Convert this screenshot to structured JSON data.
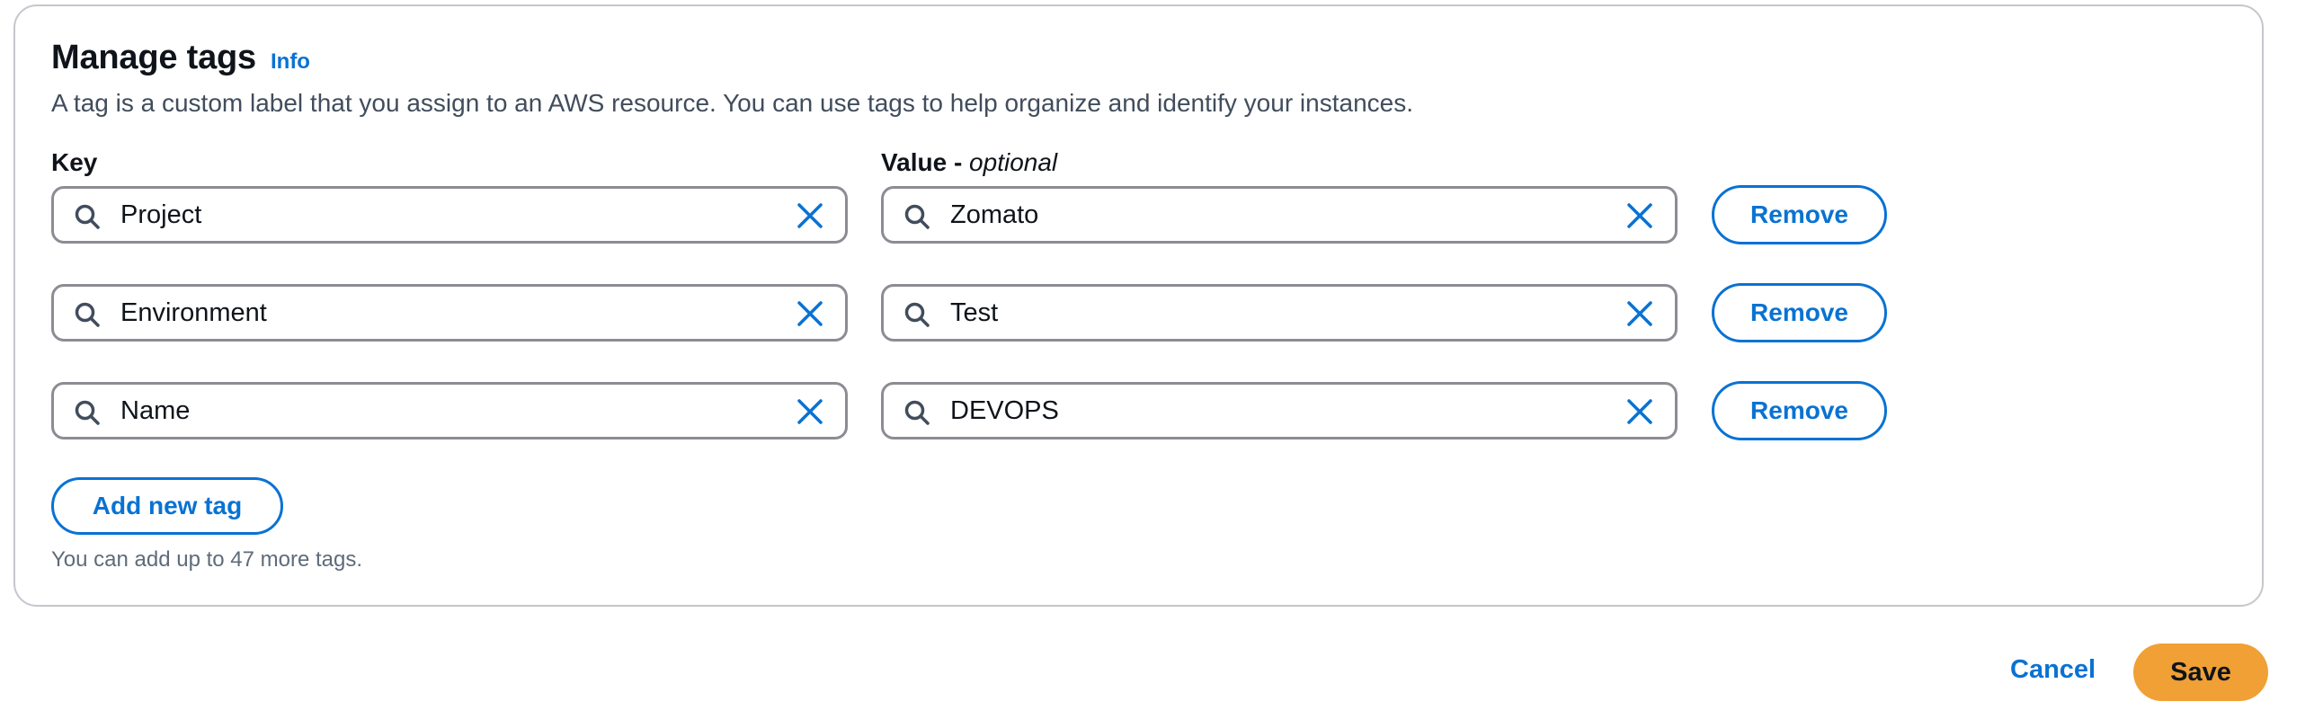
{
  "header": {
    "title": "Manage tags",
    "info_link": "Info"
  },
  "description": "A tag is a custom label that you assign to an AWS resource. You can use tags to help organize and identify your instances.",
  "columns": {
    "key_label": "Key",
    "value_label": "Value -",
    "value_optional": "optional"
  },
  "tags": [
    {
      "key": "Project",
      "value": "Zomato",
      "remove_label": "Remove"
    },
    {
      "key": "Environment",
      "value": "Test",
      "remove_label": "Remove"
    },
    {
      "key": "Name",
      "value": "DEVOPS",
      "remove_label": "Remove"
    }
  ],
  "add_tag_label": "Add new tag",
  "hint": "You can add up to 47 more tags.",
  "footer": {
    "cancel_label": "Cancel",
    "save_label": "Save"
  },
  "colors": {
    "accent": "#0972d3",
    "primary_button": "#f0a035",
    "border": "#8c8c94",
    "panel_border": "#c6c6cd"
  },
  "icons": {
    "field_leading": "search-icon",
    "field_trailing": "clear-icon"
  }
}
